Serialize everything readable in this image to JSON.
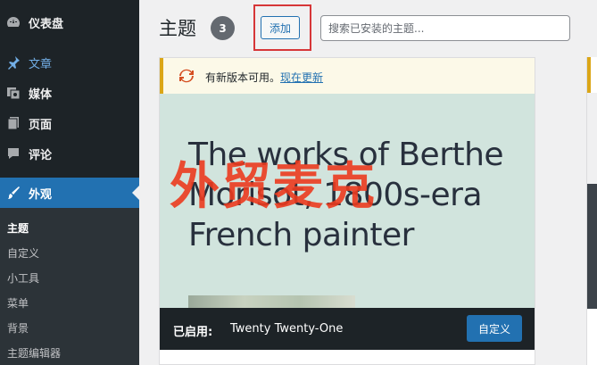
{
  "sidebar": {
    "items": [
      {
        "label": "仪表盘",
        "icon": "dashboard-icon"
      },
      {
        "label": "文章",
        "icon": "pin-icon"
      },
      {
        "label": "媒体",
        "icon": "media-icon"
      },
      {
        "label": "页面",
        "icon": "page-icon"
      },
      {
        "label": "评论",
        "icon": "comment-icon"
      },
      {
        "label": "外观",
        "icon": "paintbrush-icon"
      }
    ],
    "submenu": [
      "主题",
      "自定义",
      "小工具",
      "菜单",
      "背景",
      "主题编辑器"
    ]
  },
  "header": {
    "title": "主题",
    "count": "3",
    "add_label": "添加",
    "search_placeholder": "搜索已安装的主题..."
  },
  "theme_card": {
    "notice_text": "有新版本可用。",
    "notice_link": "现在更新",
    "screenshot_text": "The works of Berthe Morisot, 1800s-era French painter",
    "status_label": "已启用:",
    "theme_name": "Twenty Twenty-One",
    "customize_label": "自定义"
  },
  "watermark": "外贸麦克",
  "colors": {
    "sidebar_bg": "#1d2327",
    "accent": "#2271b1",
    "notice_border": "#dba617",
    "highlight": "#d63638",
    "watermark": "#ec3b1f"
  }
}
